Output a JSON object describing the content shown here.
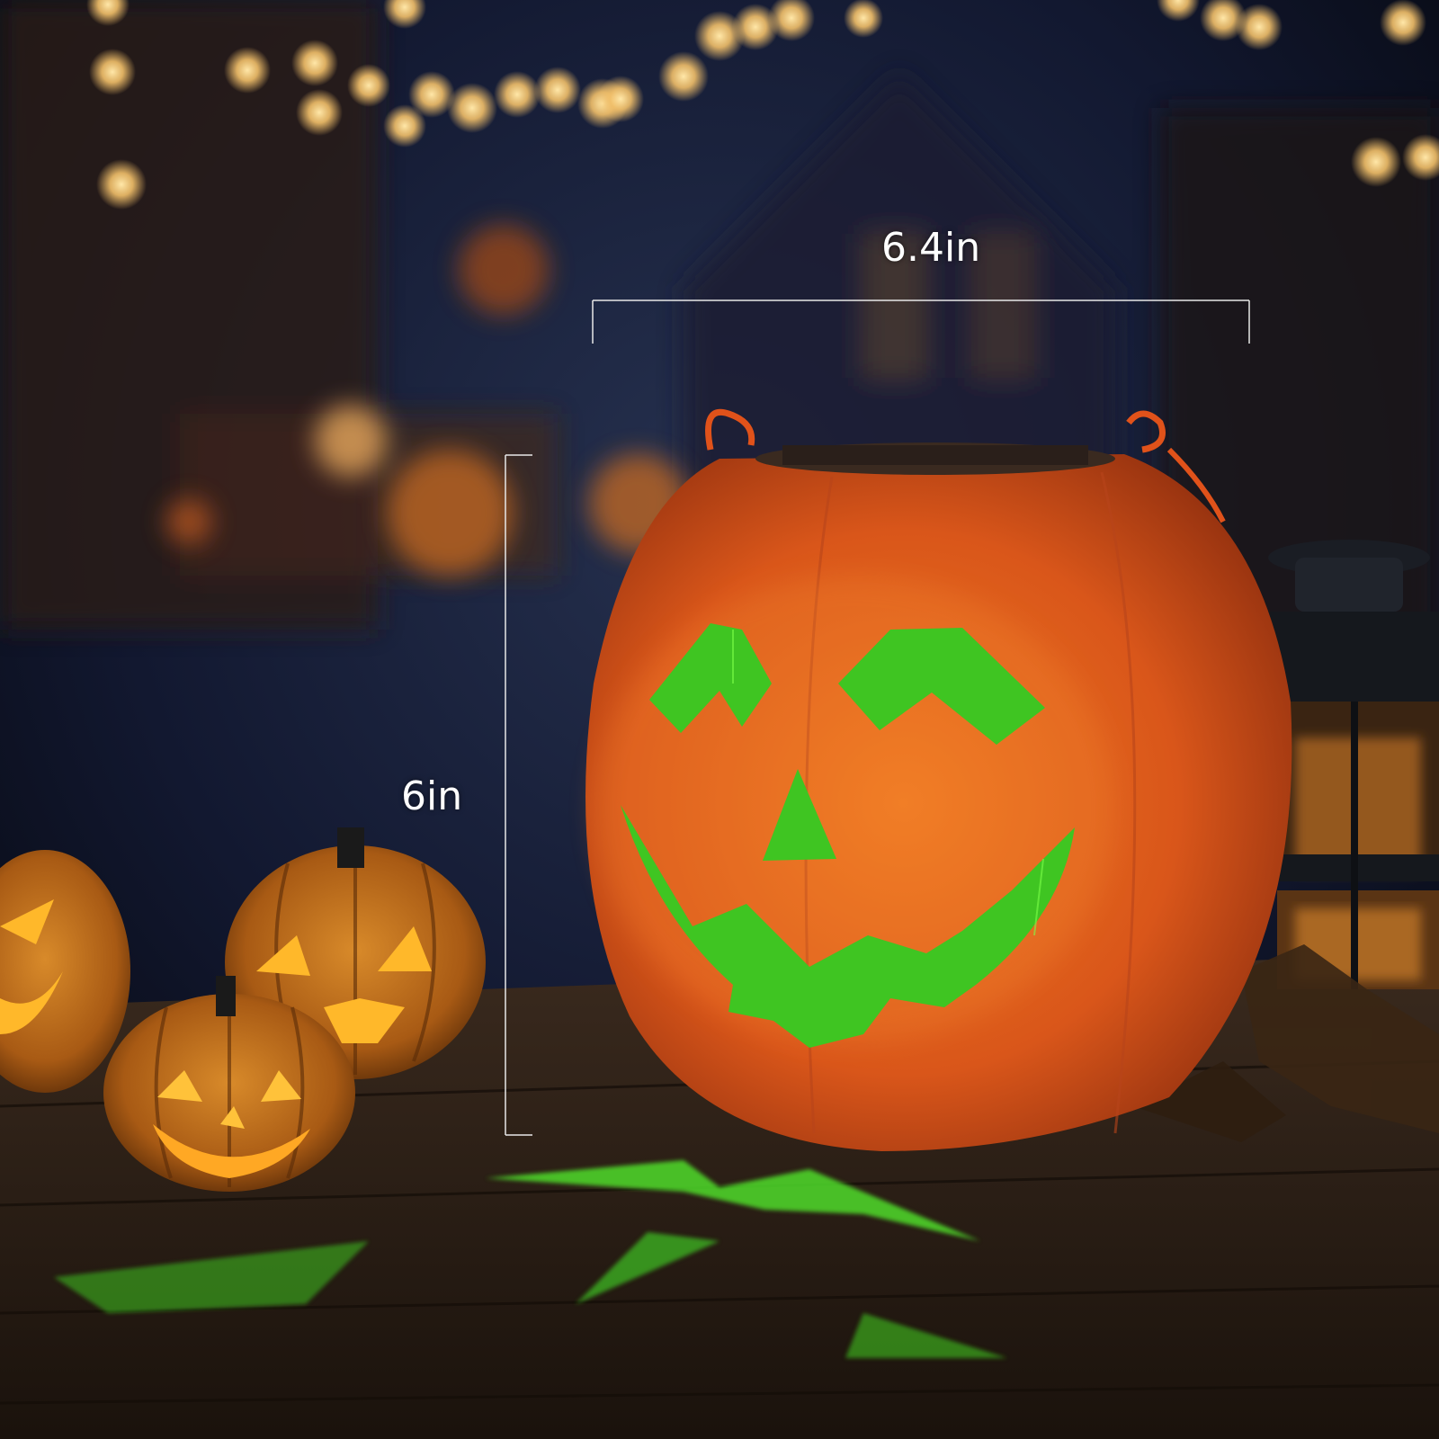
{
  "dimensions": {
    "width_label": "6.4in",
    "height_label": "6in"
  },
  "colors": {
    "pumpkin_orange": "#e8661a",
    "glow_green": "#3fc522",
    "night_sky": "#0b0f1e",
    "table_wood": "#2a1d14"
  },
  "objects": [
    "pumpkin-lantern",
    "carved-pumpkin",
    "lantern",
    "string-lights"
  ]
}
